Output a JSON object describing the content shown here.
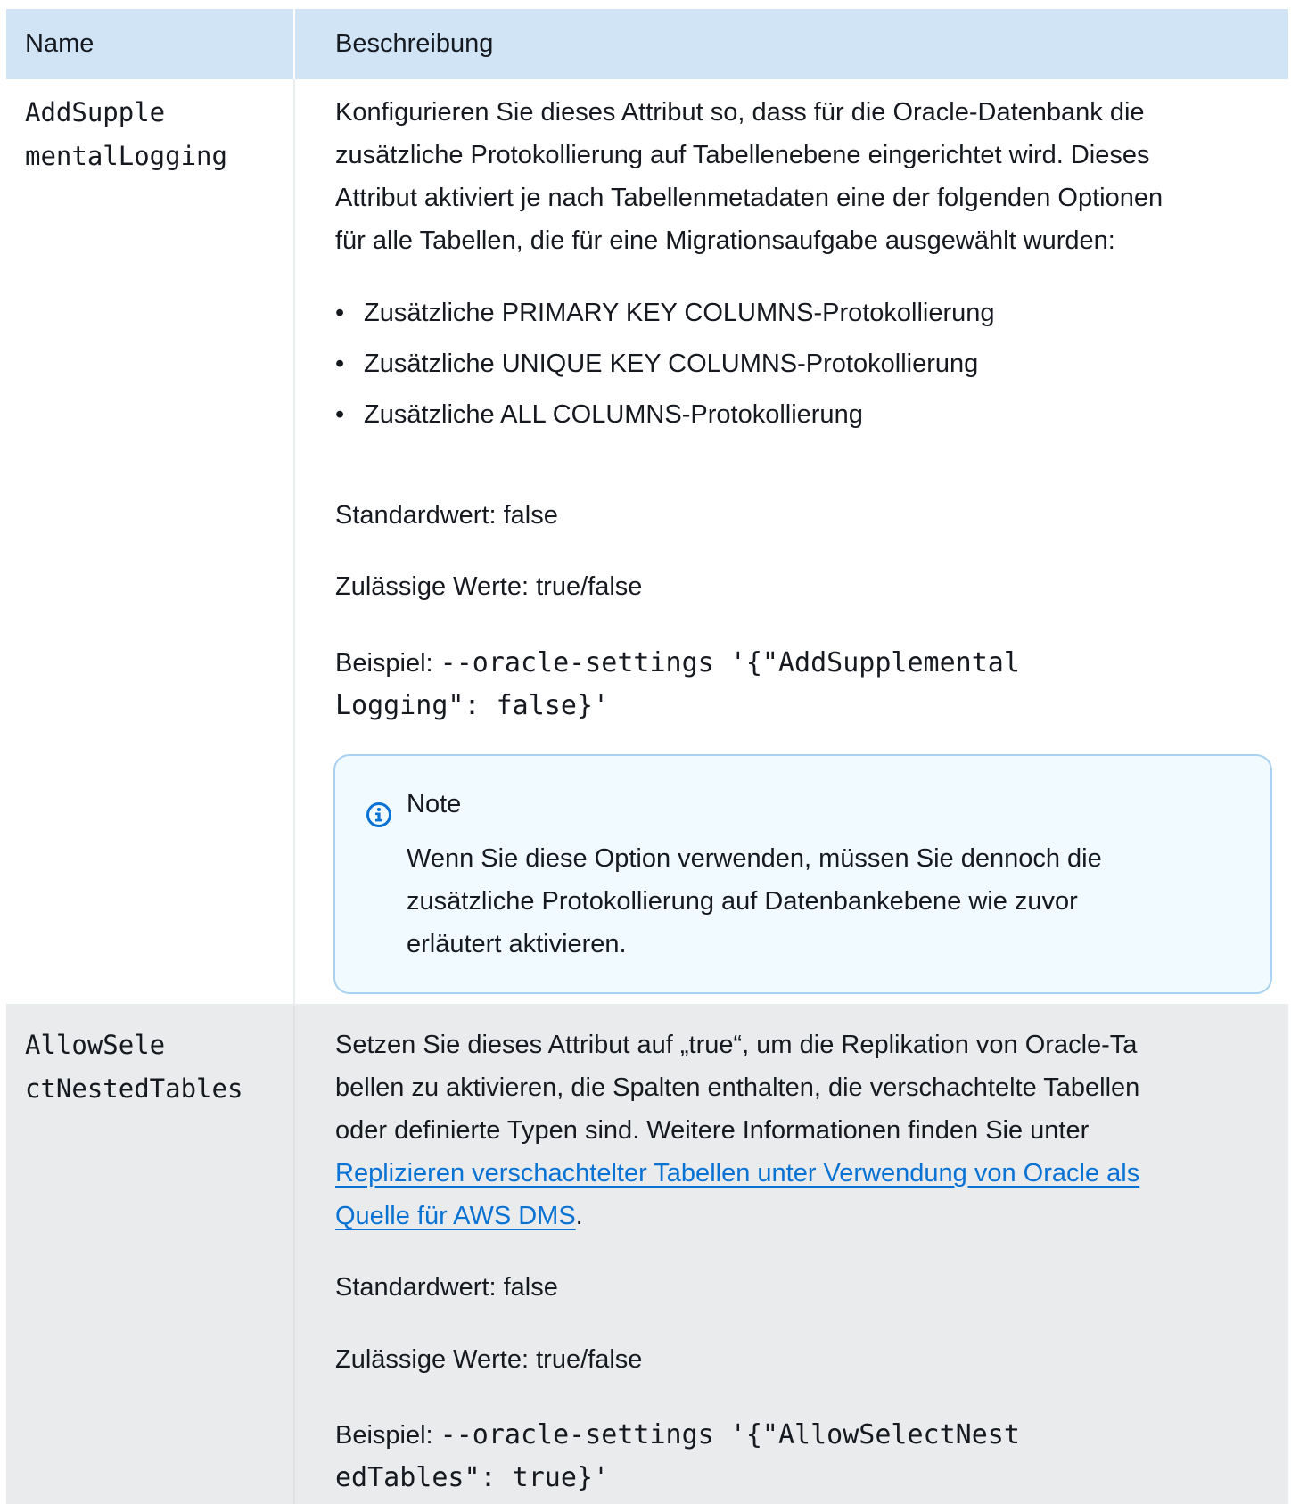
{
  "table": {
    "header": {
      "name": "Name",
      "description": "Beschreibung"
    },
    "rows": [
      {
        "name_lines": [
          "AddSupple",
          "mentalLogging"
        ],
        "description_lines": [
          "Konfigurieren Sie dieses Attribut so, dass für die Oracle-Datenbank die",
          "zusätzliche Protokollierung auf Tabellenebene eingerichtet wird. Dieses",
          "Attribut aktiviert je nach Tabellenmetadaten eine der folgenden Optionen",
          "für alle Tabellen, die für eine Migrationsaufgabe ausgewählt wurden:"
        ],
        "bullets": [
          "Zusätzliche PRIMARY KEY COLUMNS-Protokollierung",
          "Zusätzliche UNIQUE KEY COLUMNS-Protokollierung",
          "Zusätzliche ALL COLUMNS-Protokollierung"
        ],
        "default_value": "Standardwert: false",
        "allowed_values": "Zulässige Werte: true/false",
        "example_label": "Beispiel: ",
        "example_code_lines": [
          "--oracle-settings '{\"AddSupplemental",
          "Logging\": false}'"
        ],
        "note": {
          "title": "Note",
          "body_lines": [
            "Wenn Sie diese Option verwenden, müssen Sie dennoch die",
            "zusätzliche Protokollierung auf Datenbankebene wie zuvor",
            "erläutert aktivieren."
          ]
        }
      },
      {
        "name_lines": [
          "AllowSele",
          "ctNestedTables"
        ],
        "description_lines": [
          "Setzen Sie dieses Attribut auf „true“, um die Replikation von Oracle-Ta",
          "bellen zu aktivieren, die Spalten enthalten, die verschachtelte Tabellen",
          "oder definierte Typen sind. Weitere Informationen finden Sie unter"
        ],
        "link_lines": [
          "Replizieren verschachtelter Tabellen unter Verwendung von Oracle als",
          "Quelle für AWS DMS"
        ],
        "link_suffix": ".",
        "default_value": "Standardwert: false",
        "allowed_values": "Zulässige Werte: true/false",
        "example_label": "Beispiel: ",
        "example_code_lines": [
          "--oracle-settings '{\"AllowSelectNest",
          "edTables\": true}'"
        ]
      }
    ]
  }
}
